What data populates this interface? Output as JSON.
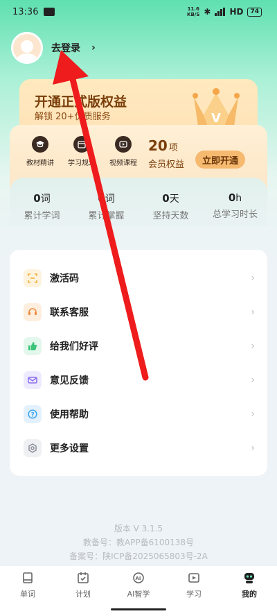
{
  "status_bar": {
    "time": "13:36",
    "network_mini_top": "11.6",
    "network_mini_bottom": "KB/S",
    "signal_label": "HD",
    "battery": "74",
    "icons": [
      "notification-icon",
      "bluetooth-icon",
      "signal-icon",
      "battery-icon"
    ]
  },
  "profile": {
    "login_label": "去登录",
    "chevron": "›"
  },
  "vip": {
    "title": "开通正式版权益",
    "subtitle": "解锁 20+优质服务",
    "benefits": [
      {
        "label": "教材精讲",
        "icon": "graduation-cap-icon"
      },
      {
        "label": "学习规划",
        "icon": "plan-icon"
      },
      {
        "label": "视频课程",
        "icon": "play-icon"
      }
    ],
    "member_count": "20",
    "member_unit": "项",
    "member_label": "会员权益",
    "open_button": "立即开通",
    "accent": "#7a3e0a"
  },
  "stats": [
    {
      "value": "0",
      "unit": "词",
      "label": "累计学词"
    },
    {
      "value": "0",
      "unit": "词",
      "label": "累计掌握"
    },
    {
      "value": "0",
      "unit": "天",
      "label": "坚持天数"
    },
    {
      "value": "0",
      "unit": "h",
      "label": "总学习时长"
    }
  ],
  "menu": [
    {
      "label": "激活码",
      "icon": "scan-icon",
      "color": "#f2b23a",
      "bg": "#fdf3de"
    },
    {
      "label": "联系客服",
      "icon": "headset-icon",
      "color": "#f0883a",
      "bg": "#fdeede"
    },
    {
      "label": "给我们好评",
      "icon": "thumbs-up-icon",
      "color": "#3cc47a",
      "bg": "#e3f7ec"
    },
    {
      "label": "意见反馈",
      "icon": "mail-icon",
      "color": "#8a6ef0",
      "bg": "#eeeafd"
    },
    {
      "label": "使用帮助",
      "icon": "help-icon",
      "color": "#3aa3f0",
      "bg": "#e2f1fd"
    },
    {
      "label": "更多设置",
      "icon": "gear-icon",
      "color": "#8a8f99",
      "bg": "#eef0f3"
    }
  ],
  "footer": {
    "version": "版本 V 3.1.5",
    "edu_record": "教备号：教APP备6100138号",
    "icp_record": "备案号：陕ICP备2025065803号-2A"
  },
  "tabs": [
    {
      "label": "单词",
      "icon": "book-icon",
      "active": false
    },
    {
      "label": "计划",
      "icon": "calendar-icon",
      "active": false
    },
    {
      "label": "AI智学",
      "icon": "ai-icon",
      "active": false
    },
    {
      "label": "学习",
      "icon": "video-icon",
      "active": false
    },
    {
      "label": "我的",
      "icon": "robot-icon",
      "active": true
    }
  ],
  "annotation": {
    "color": "#ee1c1c",
    "icon": "red-arrow-annotation"
  }
}
